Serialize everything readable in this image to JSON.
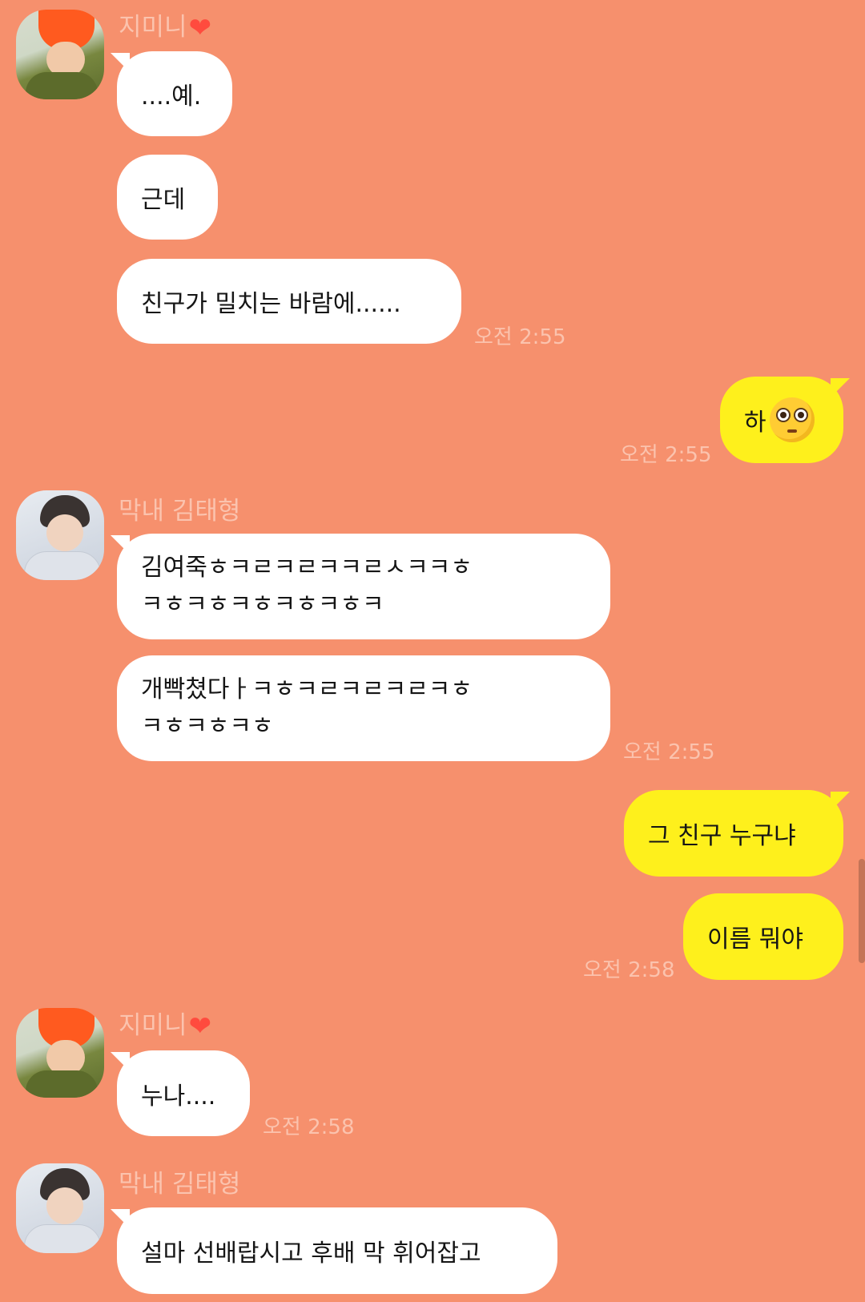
{
  "chat": {
    "senders": {
      "jimin": {
        "name": "지미니",
        "heart": "❤"
      },
      "tae": {
        "name": "막내 김태형"
      }
    },
    "messages": {
      "m1": "....예.",
      "m2": "근데",
      "m3": "친구가 밀치는 바람에......",
      "t1": "오전 2:55",
      "m4": "하",
      "t2": "오전 2:55",
      "m5_line1": "김여죽ㅎㅋㄹㅋㄹㅋㅋㄹㅅㅋㅋㅎ",
      "m5_line2": "ㅋㅎㅋㅎㅋㅎㅋㅎㅋㅎㅋ",
      "m6_line1": "개빡쳤다ㅏㅋㅎㅋㄹㅋㄹㅋㄹㅋㅎ",
      "m6_line2": "ㅋㅎㅋㅎㅋㅎ",
      "t3": "오전 2:55",
      "m7": "그 친구 누구냐",
      "m8": "이름 뭐야",
      "t4": "오전 2:58",
      "m9": "누나....",
      "t5": "오전 2:58",
      "m10": "설마 선배랍시고 후배 막 휘어잡고"
    },
    "emoji": "pleading-face",
    "colors": {
      "background": "#f6906d",
      "incoming_bubble": "#ffffff",
      "outgoing_bubble": "#fef01c",
      "meta_text": "#fbc3ae"
    }
  }
}
